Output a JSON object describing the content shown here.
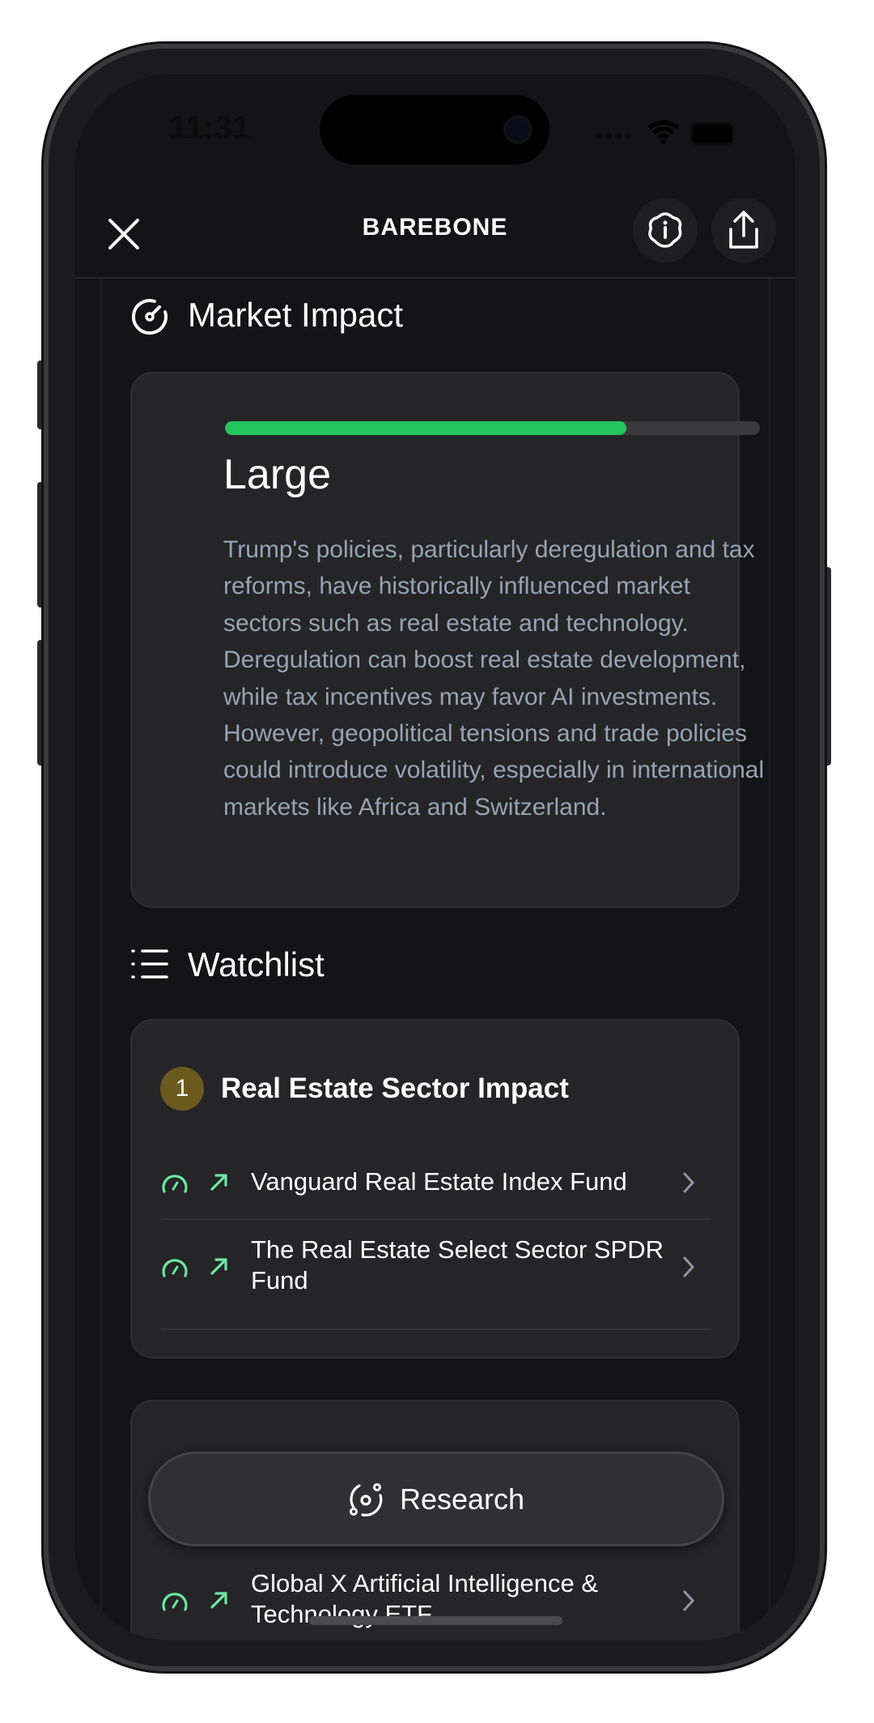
{
  "status_bar": {
    "time": "11:31"
  },
  "header": {
    "logo": "BAREBONE",
    "icons": [
      "close-icon",
      "info-icon",
      "share-icon"
    ]
  },
  "market_impact": {
    "heading": "Market Impact",
    "progress": 0.75,
    "level": "Large",
    "description": "Trump's policies, particularly deregulation and tax reforms, have historically influenced market sectors such as real estate and technology. Deregulation can boost real estate development, while tax incentives may favor AI investments. However, geopolitical tensions and trade policies could introduce volatility, especially in international markets like Africa and Switzerland."
  },
  "watchlist": {
    "heading": "Watchlist",
    "groups": [
      {
        "number": "1",
        "title": "Real Estate Sector Impact",
        "items": [
          {
            "name": "Vanguard Real Estate Index Fund"
          },
          {
            "name": "The Real Estate Select Sector SPDR Fund"
          }
        ]
      },
      {
        "items": [
          {
            "name": "Global X Artificial Intelligence & Technology ETF"
          }
        ]
      }
    ]
  },
  "research_button": {
    "label": "Research"
  },
  "colors": {
    "accent": "#22c55e",
    "icon_green": "#6ee7a0",
    "badge": "#6b5a1e",
    "muted_text": "#98a2b3"
  }
}
